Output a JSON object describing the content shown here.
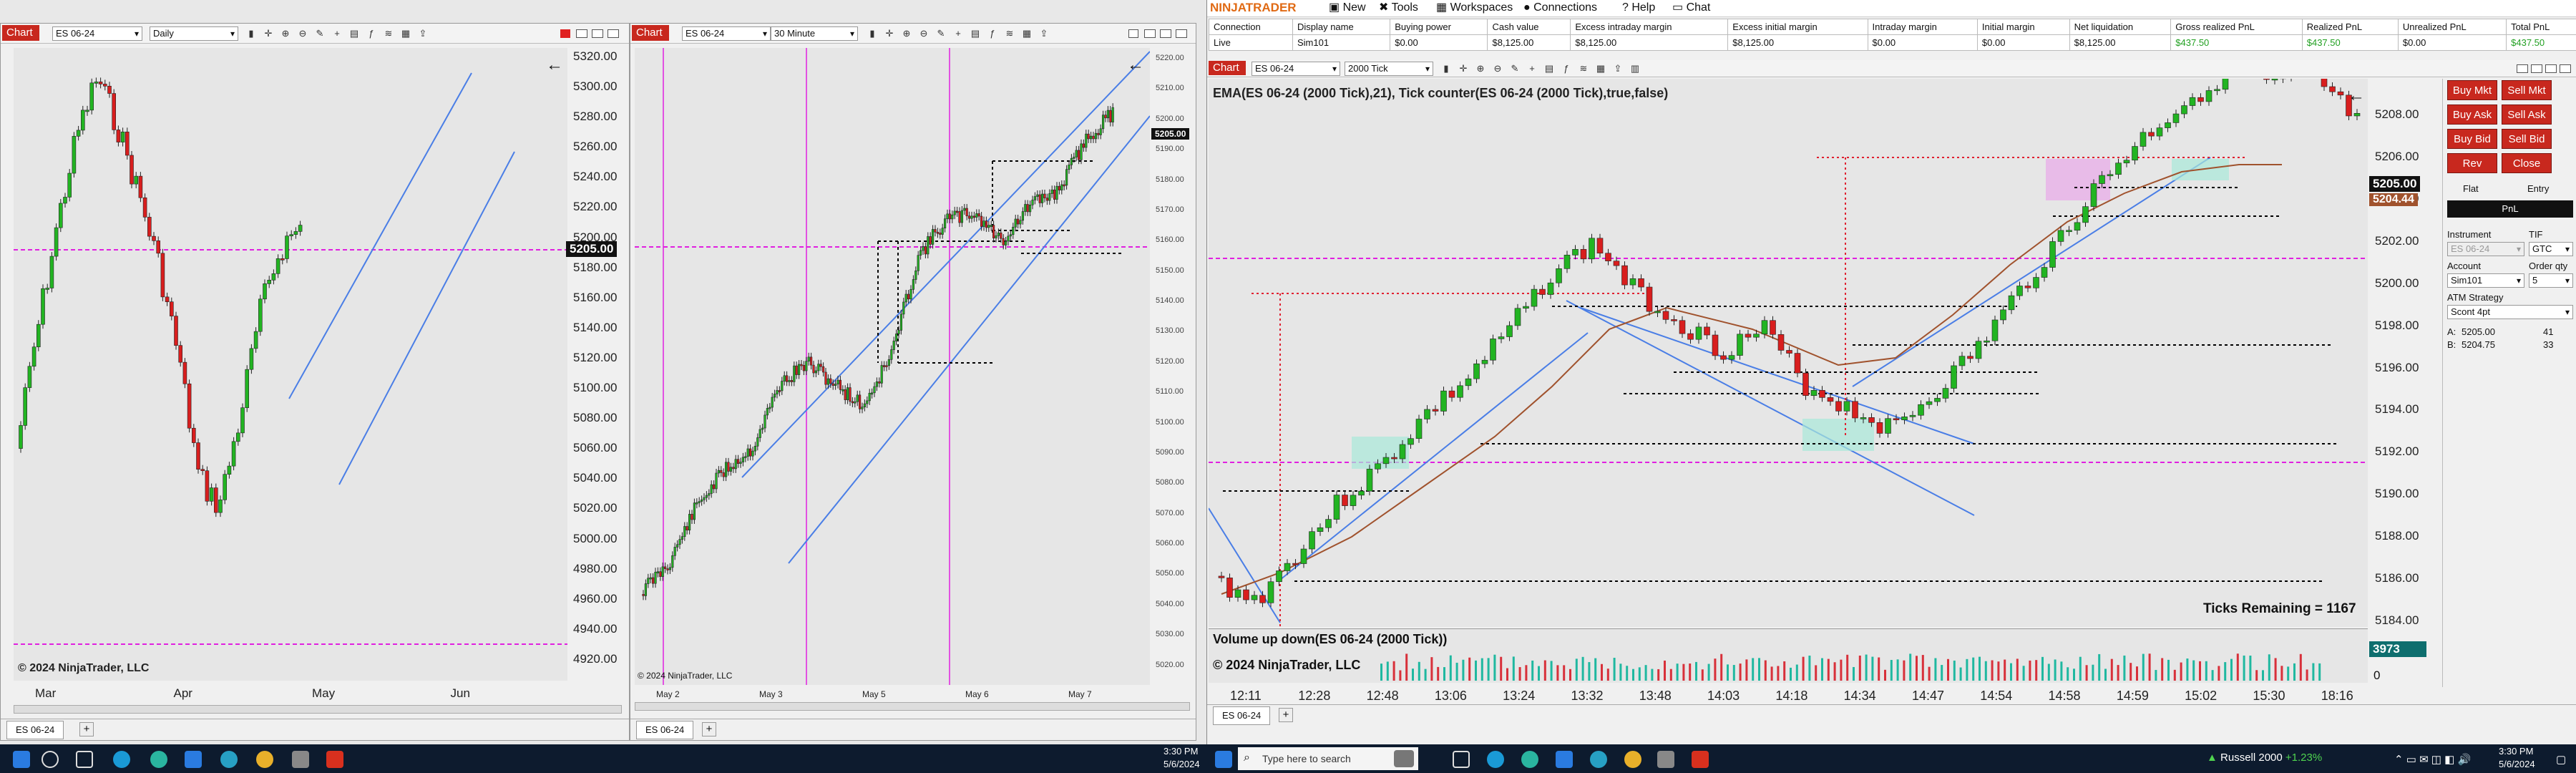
{
  "chart1": {
    "label": "Chart",
    "instrument": "ES 06-24",
    "interval": "Daily",
    "y_ticks": [
      "5320.00",
      "5300.00",
      "5280.00",
      "5260.00",
      "5240.00",
      "5220.00",
      "5200.00",
      "5180.00",
      "5160.00",
      "5140.00",
      "5120.00",
      "5100.00",
      "5080.00",
      "5060.00",
      "5040.00",
      "5020.00",
      "5000.00",
      "4980.00",
      "4960.00",
      "4940.00",
      "4920.00"
    ],
    "x_ticks": [
      "Mar",
      "Apr",
      "May",
      "Jun"
    ],
    "price_badge": "5205.00",
    "copyright": "© 2024 NinjaTrader, LLC",
    "tab": "ES 06-24",
    "back_icon": "←"
  },
  "chart2": {
    "label": "Chart",
    "instrument": "ES 06-24",
    "interval": "30 Minute",
    "y_ticks": [
      "5220.00",
      "5210.00",
      "5200.00",
      "5190.00",
      "5180.00",
      "5170.00",
      "5160.00",
      "5150.00",
      "5140.00",
      "5130.00",
      "5120.00",
      "5110.00",
      "5100.00",
      "5090.00",
      "5080.00",
      "5070.00",
      "5060.00",
      "5050.00",
      "5040.00",
      "5030.00",
      "5020.00"
    ],
    "price_badge": "5205.00",
    "x_ticks": [
      "May 2",
      "May 3",
      "May 5",
      "May 6",
      "May 7"
    ],
    "copyright": "© 2024 NinjaTrader, LLC",
    "tab": "ES 06-24",
    "back_icon": "←"
  },
  "main": {
    "brand": "NINJATRADER",
    "menu": [
      "New",
      "Tools",
      "Workspaces",
      "Connections",
      "Help",
      "Chat"
    ],
    "account_headers": [
      "Connection",
      "Display name",
      "Buying power",
      "Cash value",
      "Excess intraday margin",
      "Excess initial margin",
      "Intraday margin",
      "Initial margin",
      "Net liquidation",
      "Gross realized PnL",
      "Realized PnL",
      "Unrealized PnL",
      "Total PnL"
    ],
    "account_values": [
      "Live",
      "Sim101",
      "$0.00",
      "$8,125.00",
      "$8,125.00",
      "$8,125.00",
      "$0.00",
      "$0.00",
      "$8,125.00",
      "$437.50",
      "$437.50",
      "$0.00",
      "$437.50"
    ],
    "chart_label": "Chart",
    "instrument": "ES 06-24",
    "interval": "2000 Tick",
    "indicator_title": "EMA(ES 06-24 (2000 Tick),21), Tick counter(ES 06-24 (2000 Tick),true,false)",
    "y_ticks": [
      "5208.00",
      "5206.00",
      "5204.00",
      "5202.00",
      "5200.00",
      "5198.00",
      "5196.00",
      "5194.00",
      "5192.00",
      "5190.00",
      "5188.00",
      "5186.00",
      "5184.00"
    ],
    "price_badge": "5205.00",
    "price_badge2": "5204.44",
    "ticks_remaining": "Ticks Remaining = 1167",
    "volume_title": "Volume up down(ES 06-24 (2000 Tick))",
    "copyright": "© 2024 NinjaTrader, LLC",
    "volume_badge": "3973",
    "volume_zero": "0",
    "x_ticks": [
      "12:11",
      "12:28",
      "12:48",
      "13:06",
      "13:24",
      "13:32",
      "13:48",
      "14:03",
      "14:18",
      "14:34",
      "14:47",
      "14:54",
      "14:58",
      "14:59",
      "15:02",
      "15:30",
      "18:16"
    ],
    "tab": "ES 06-24",
    "back_icon": "←"
  },
  "chart_trader": {
    "buttons": [
      "Buy Mkt",
      "Sell Mkt",
      "Buy Ask",
      "Sell Ask",
      "Buy Bid",
      "Sell Bid",
      "Rev",
      "Close"
    ],
    "flat": "Flat",
    "entry": "Entry",
    "pnl": "PnL",
    "instrument_label": "Instrument",
    "instrument_value": "ES 06-24",
    "tif_label": "TIF",
    "tif_value": "GTC",
    "account_label": "Account",
    "account_value": "Sim101",
    "order_qty_label": "Order qty",
    "order_qty_value": "5",
    "atm_label": "ATM Strategy",
    "atm_value": "Scont 4pt",
    "ask_label": "A:",
    "ask_price": "5205.00",
    "ask_size": "41",
    "bid_label": "B:",
    "bid_price": "5204.75",
    "bid_size": "33"
  },
  "taskbar_left": {
    "time": "3:30 PM",
    "date": "5/6/2024"
  },
  "taskbar_right": {
    "search_placeholder": "Type here to search",
    "ticker": "Russell 2000",
    "ticker_change": "+1.23%",
    "time": "3:30 PM",
    "date": "5/6/2024"
  },
  "colors": {
    "accent": "#c8281e",
    "up": "#22b422",
    "down": "#d81e1e",
    "trend": "#4a7ee6",
    "magenta": "#e020e0"
  }
}
